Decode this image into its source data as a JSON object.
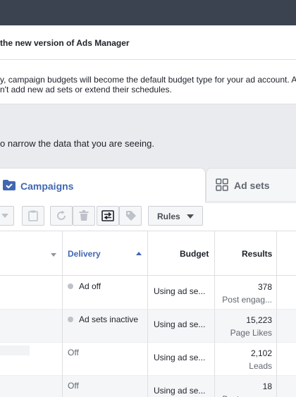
{
  "notice": {
    "title": "the new version of Ads Manager",
    "body_line1": "y, campaign budgets will become the default budget type for your ad account. A",
    "body_line2": "n't add new ad sets or extend their schedules."
  },
  "filter_hint": "o narrow the data that you are seeing.",
  "tabs": {
    "campaigns": {
      "label": "Campaigns",
      "icon": "folder-check-icon"
    },
    "adsets": {
      "label": "Ad sets",
      "icon": "grid-icon"
    }
  },
  "toolbar": {
    "rules_label": "Rules",
    "icons": [
      "dropdown-icon",
      "clipboard-icon",
      "refresh-icon",
      "trash-icon",
      "compare-icon",
      "tag-icon"
    ]
  },
  "table": {
    "headers": {
      "delivery": "Delivery",
      "budget": "Budget",
      "results": "Results"
    },
    "rows": [
      {
        "delivery": "Ad off",
        "budget": "Using ad se...",
        "result_value": "378",
        "result_type": "Post engag..."
      },
      {
        "delivery": "Ad sets inactive",
        "budget": "Using ad se...",
        "result_value": "15,223",
        "result_type": "Page Likes"
      },
      {
        "delivery": "Off",
        "budget": "Using ad se...",
        "result_value": "2,102",
        "result_type": "Leads"
      },
      {
        "delivery": "Off",
        "budget": "Using ad se...",
        "result_value": "18",
        "result_type": "Post engag..."
      }
    ]
  },
  "colors": {
    "accent": "#4267b2",
    "topbar": "#3b4351"
  }
}
